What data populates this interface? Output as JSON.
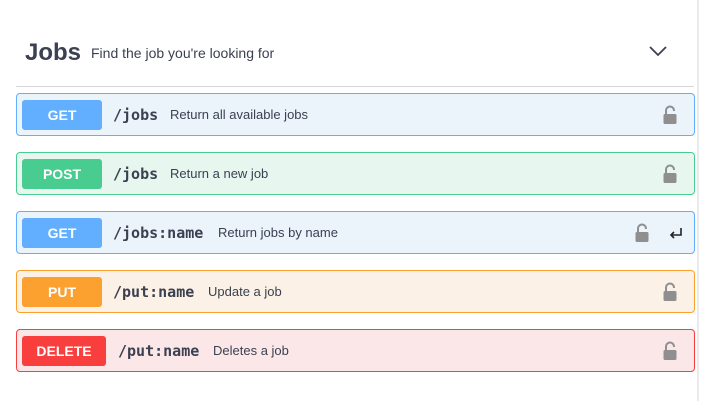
{
  "tag": {
    "title": "Jobs",
    "description": "Find the job you're looking for",
    "toggle_icon": "chevron-down-icon"
  },
  "operations": [
    {
      "method": "GET",
      "path": "/jobs",
      "summary": "Return all available jobs",
      "icon": "lock-icon"
    },
    {
      "method": "POST",
      "path": "/jobs",
      "summary": "Return a new job",
      "icon": "lock-icon"
    },
    {
      "method": "GET",
      "path": "/jobs:name",
      "summary": "Return jobs by name",
      "icon": "lock-icon",
      "extra_icon": "enter-icon"
    },
    {
      "method": "PUT",
      "path": "/put:name",
      "summary": "Update a job",
      "icon": "lock-icon"
    },
    {
      "method": "DELETE",
      "path": "/put:name",
      "summary": "Deletes a job",
      "icon": "lock-icon"
    }
  ],
  "colors": {
    "get": "#61affe",
    "post": "#49cc90",
    "put": "#fca130",
    "delete": "#f93e3e",
    "text": "#3b4151",
    "lock": "#8f8f8f"
  }
}
